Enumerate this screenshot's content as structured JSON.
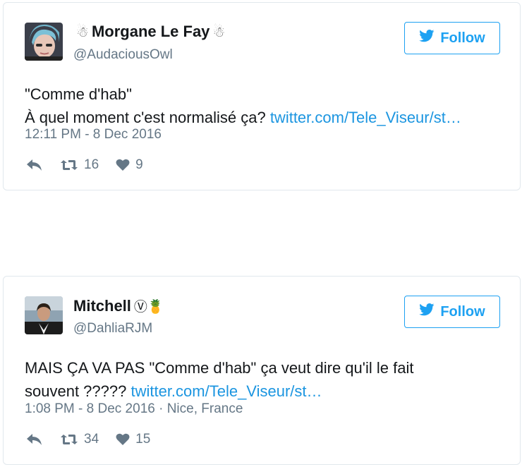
{
  "colors": {
    "accent": "#1da1f2",
    "link": "#1b95e0",
    "muted": "#657786",
    "border": "#e1e8ed"
  },
  "tweets": [
    {
      "display_name": "Morgane Le Fay",
      "name_prefix_emoji": "☃",
      "name_suffix_emoji": "☃",
      "handle": "@AudaciousOwl",
      "follow_label": "Follow",
      "text_lines": [
        "\"Comme d'hab\"",
        "À quel moment c'est normalisé ça? "
      ],
      "link": "twitter.com/Tele_Viseur/st…",
      "timestamp": "12:11 PM - 8 Dec 2016",
      "retweets": "16",
      "likes": "9",
      "icons": [
        "twitter-bird-icon",
        "reply-icon",
        "retweet-icon",
        "heart-icon"
      ]
    },
    {
      "display_name": "Mitchell",
      "name_suffix_emoji": "Ⓥ🍍",
      "handle": "@DahliaRJM",
      "follow_label": "Follow",
      "text_lines": [
        "MAIS ÇA VA PAS \"Comme d'hab\" ça veut dire qu'il le fait",
        "souvent ????? "
      ],
      "link": "twitter.com/Tele_Viseur/st…",
      "timestamp": "1:08 PM - 8 Dec 2016 · Nice, France",
      "retweets": "34",
      "likes": "15",
      "icons": [
        "twitter-bird-icon",
        "reply-icon",
        "retweet-icon",
        "heart-icon"
      ]
    }
  ]
}
